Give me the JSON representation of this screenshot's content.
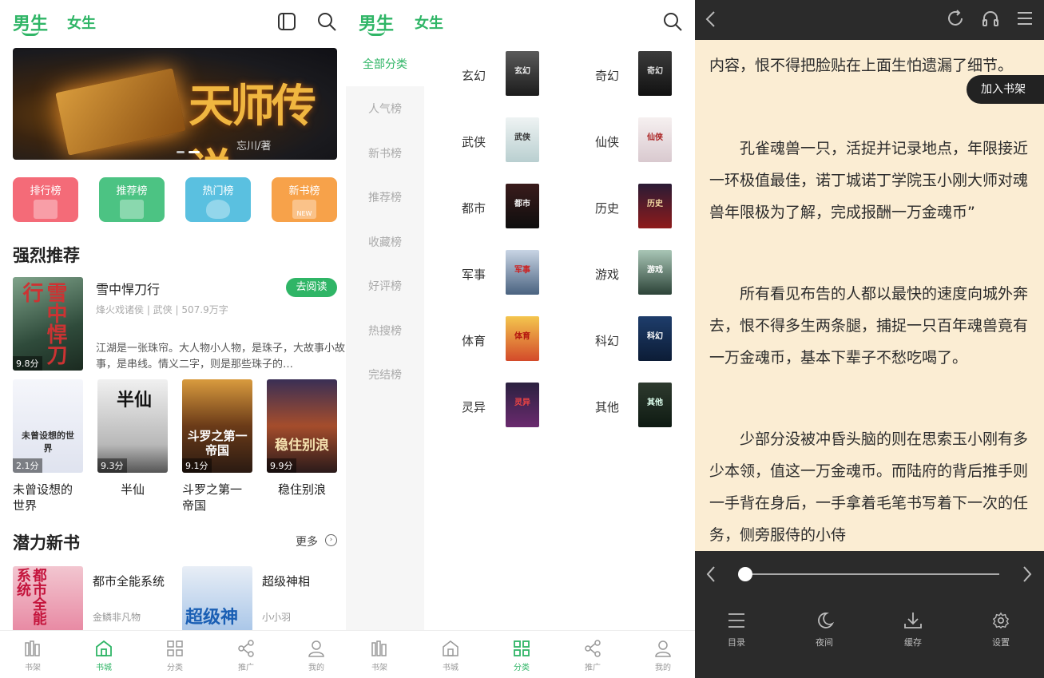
{
  "store": {
    "tabs": [
      "男生",
      "女生"
    ],
    "banner": {
      "title": "天师传说",
      "author": "忘川/著"
    },
    "rank_buttons": [
      "排行榜",
      "推荐榜",
      "热门榜",
      "新书榜"
    ],
    "rank_colors": [
      "#f46b78",
      "#4cc383",
      "#5ac0e0",
      "#f7a24a"
    ],
    "new_badge": "NEW",
    "section_recommend": "强烈推荐",
    "featured": {
      "title": "雪中悍刀行",
      "meta": "烽火戏诸侯 | 武侠 | 507.9万字",
      "description": "江湖是一张珠帘。大人物小人物，是珠子，大故事小故事，是串线。情义二字，则是那些珠子的…",
      "score": "9.8分",
      "read_label": "去阅读"
    },
    "grid_books": [
      {
        "title": "未曾设想的世界",
        "score": "2.1分"
      },
      {
        "title": "半仙",
        "score": "9.3分"
      },
      {
        "title": "斗罗之第一帝国",
        "score": "9.1分"
      },
      {
        "title": "稳住别浪",
        "score": "9.9分"
      }
    ],
    "section_new": "潜力新书",
    "more_label": "更多",
    "new_books": [
      {
        "title": "都市全能系统",
        "author": "金鳞非凡物"
      },
      {
        "title": "超级神相",
        "author": "小小羽"
      }
    ]
  },
  "nav": [
    "书架",
    "书城",
    "分类",
    "推广",
    "我的"
  ],
  "category": {
    "tabs": [
      "男生",
      "女生"
    ],
    "sidebar": [
      "全部分类",
      "人气榜",
      "新书榜",
      "推荐榜",
      "收藏榜",
      "好评榜",
      "热搜榜",
      "完结榜"
    ],
    "genres": [
      "玄幻",
      "奇幻",
      "武侠",
      "仙侠",
      "都市",
      "历史",
      "军事",
      "游戏",
      "体育",
      "科幻",
      "灵异",
      "其他"
    ]
  },
  "reader": {
    "paragraphs": [
      "内容，恨不得把脸贴在上面生怕遗漏了细节。",
      "孔雀魂兽一只，活捉并记录地点，年限接近一环极值最佳，诺丁城诺丁学院玉小刚大师对魂兽年限极为了解，完成报酬一万金魂币”",
      "所有看见布告的人都以最快的速度向城外奔去，恨不得多生两条腿，捕捉一只百年魂兽竟有一万金魂币，基本下辈子不愁吃喝了。",
      "少部分没被冲昏头脑的则在思索玉小刚有多少本领，值这一万金魂币。而陆府的背后推手则一手背在身后，一手拿着毛笔书写着下一次的任务，侧旁服侍的小侍"
    ],
    "add_shelf": "加入书架",
    "progress": 0.02,
    "tools": [
      "目录",
      "夜间",
      "缓存",
      "设置"
    ]
  },
  "accent": "#2fb566"
}
